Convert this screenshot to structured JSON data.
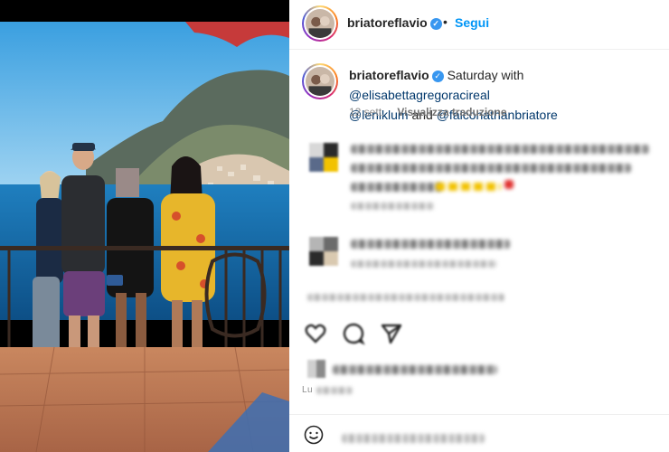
{
  "post": {
    "author": "briatoreflavio",
    "verified_label": "✓",
    "follow_label": "Segui",
    "separator": "•"
  },
  "caption": {
    "username": "briatoreflavio",
    "text_prefix": " Saturday with ",
    "mention_1": "@elisabettagregoracireal",
    "mention_2": "@leniklum",
    "text_and": " and ",
    "mention_3": "@falconathanbriatore"
  },
  "meta": {
    "time_ago": "12 sett.",
    "translate_label": "Visualizza traduzione"
  },
  "comments_footer": {
    "partial_label": "Lu"
  },
  "icons": {
    "verified": "verified-badge-icon",
    "like": "heart-icon",
    "comment": "comment-icon",
    "share": "share-icon",
    "emoji": "emoji-icon"
  },
  "colors": {
    "accent": "#0095f6",
    "verified": "#3897f0",
    "mention": "#00376b",
    "muted": "#8e8e8e"
  }
}
